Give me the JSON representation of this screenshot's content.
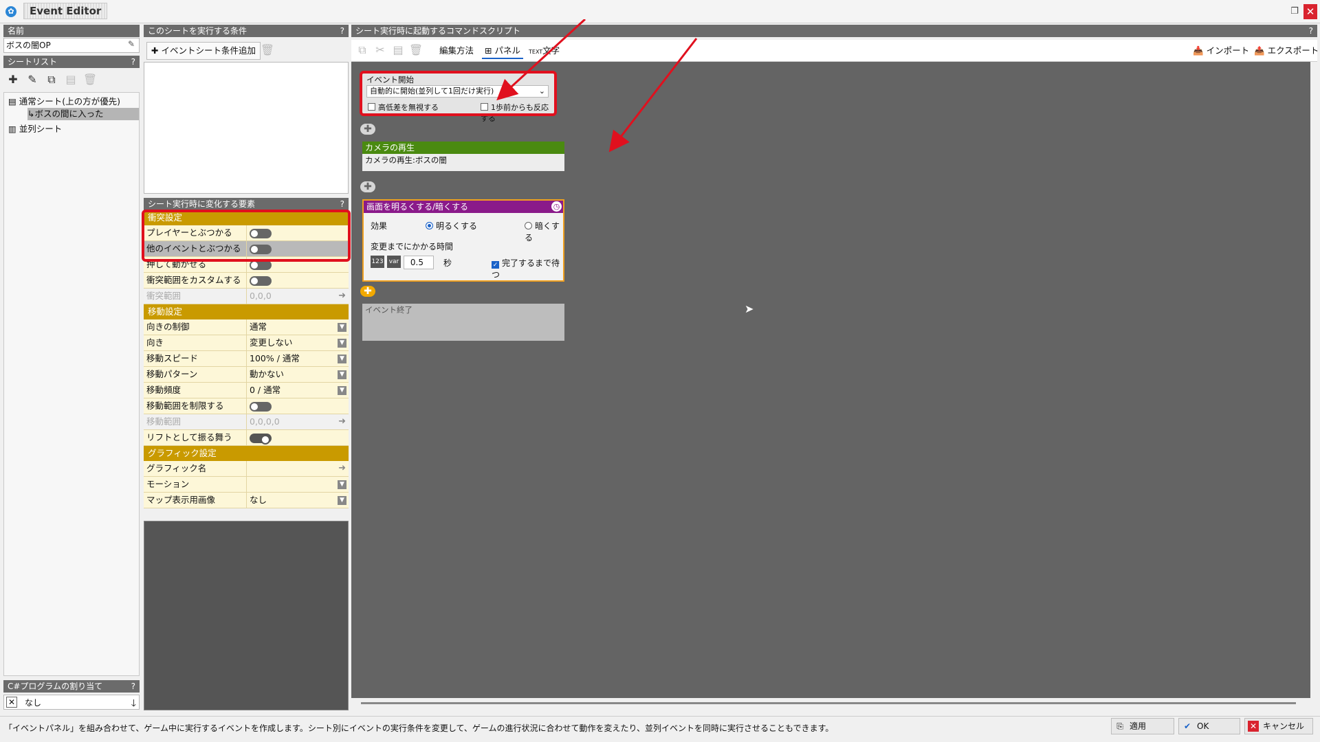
{
  "window": {
    "title": "Event Editor",
    "app_icon": "gear-icon",
    "restore_icon": "restore-window-icon",
    "close_icon": "close-icon"
  },
  "left": {
    "name_label": "名前",
    "name_value": "ボスの闇OP",
    "sheetlist_label": "シートリスト",
    "help": "?",
    "tree": [
      {
        "label": "通常シート(上の方が優先)"
      },
      {
        "label": "ボスの間に入った"
      },
      {
        "label": "並列シート"
      }
    ],
    "csharp_label": "C#プログラムの割り当て",
    "csharp_value": "なし"
  },
  "conditions": {
    "label": "このシートを実行する条件",
    "help": "?",
    "add_button": "イベントシート条件追加"
  },
  "changes": {
    "label": "シート実行時に変化する要素",
    "help": "?",
    "sections": [
      {
        "title": "衝突設定"
      },
      {
        "title": "移動設定"
      },
      {
        "title": "グラフィック設定"
      }
    ],
    "rows": [
      {
        "key": "プレイヤーとぶつかる",
        "value": ""
      },
      {
        "key": "他のイベントとぶつかる",
        "value": ""
      },
      {
        "key": "押して動かせる",
        "value": ""
      },
      {
        "key": "衝突範囲をカスタムする",
        "value": ""
      },
      {
        "key": "衝突範囲",
        "value": "0,0,0"
      },
      {
        "key": "向きの制御",
        "value": "通常"
      },
      {
        "key": "向き",
        "value": "変更しない"
      },
      {
        "key": "移動スピード",
        "value": "100% / 通常"
      },
      {
        "key": "移動パターン",
        "value": "動かない"
      },
      {
        "key": "移動頻度",
        "value": "0 / 通常"
      },
      {
        "key": "移動範囲を制限する",
        "value": ""
      },
      {
        "key": "移動範囲",
        "value": "0,0,0,0"
      },
      {
        "key": "リフトとして振る舞う",
        "value": ""
      },
      {
        "key": "グラフィック名",
        "value": ""
      },
      {
        "key": "モーション",
        "value": ""
      },
      {
        "key": "マップ表示用画像",
        "value": "なし"
      }
    ]
  },
  "script": {
    "label": "シート実行時に起動するコマンドスクリプト",
    "help": "?",
    "edit_method": "編集方法",
    "panel_mode": "パネル",
    "text_mode": "文字",
    "import": "インポート",
    "export": "エクスポート",
    "event_start": {
      "title": "イベント開始",
      "select": "自動的に開始(並列して1回だけ実行)",
      "cb1": "高低差を無視する",
      "cb2": "1歩前からも反応する"
    },
    "camera": {
      "title": "カメラの再生",
      "body": "カメラの再生:ボスの闇"
    },
    "fade": {
      "title": "画面を明るくする/暗くする",
      "effect_label": "効果",
      "opt_bright": "明るくする",
      "opt_dark": "暗くする",
      "time_label": "変更までにかかる時間",
      "num_icon": "123",
      "var_icon": "var",
      "time_value": "0.5",
      "unit": "秒",
      "wait": "完了するまで待つ"
    },
    "event_end": "イベント終了"
  },
  "status": {
    "text": "「イベントパネル」を組み合わせて、ゲーム中に実行するイベントを作成します。シート別にイベントの実行条件を変更して、ゲームの進行状況に合わせて動作を変えたり、並列イベントを同時に実行させることもできます。",
    "apply": "適用",
    "ok": "OK",
    "cancel": "キャンセル"
  },
  "colors": {
    "accent_red": "#e0101e",
    "section_gold": "#c99a00",
    "camera_green": "#4a8a10",
    "fade_purple": "#8a1a8a",
    "fade_border": "#f0a020"
  }
}
